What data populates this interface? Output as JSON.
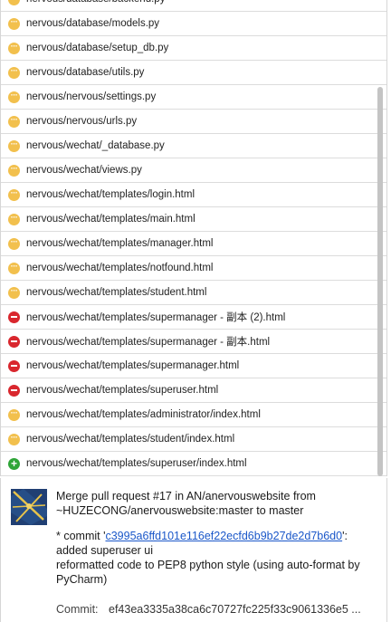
{
  "files": [
    {
      "path": "nervous/database/backend.py",
      "status": "modified"
    },
    {
      "path": "nervous/database/models.py",
      "status": "modified"
    },
    {
      "path": "nervous/database/setup_db.py",
      "status": "modified"
    },
    {
      "path": "nervous/database/utils.py",
      "status": "modified"
    },
    {
      "path": "nervous/nervous/settings.py",
      "status": "modified"
    },
    {
      "path": "nervous/nervous/urls.py",
      "status": "modified"
    },
    {
      "path": "nervous/wechat/_database.py",
      "status": "modified"
    },
    {
      "path": "nervous/wechat/views.py",
      "status": "modified"
    },
    {
      "path": "nervous/wechat/templates/login.html",
      "status": "modified"
    },
    {
      "path": "nervous/wechat/templates/main.html",
      "status": "modified"
    },
    {
      "path": "nervous/wechat/templates/manager.html",
      "status": "modified"
    },
    {
      "path": "nervous/wechat/templates/notfound.html",
      "status": "modified"
    },
    {
      "path": "nervous/wechat/templates/student.html",
      "status": "modified"
    },
    {
      "path": "nervous/wechat/templates/supermanager - 副本 (2).html",
      "status": "deleted"
    },
    {
      "path": "nervous/wechat/templates/supermanager - 副本.html",
      "status": "deleted"
    },
    {
      "path": "nervous/wechat/templates/supermanager.html",
      "status": "deleted"
    },
    {
      "path": "nervous/wechat/templates/superuser.html",
      "status": "deleted"
    },
    {
      "path": "nervous/wechat/templates/administrator/index.html",
      "status": "modified"
    },
    {
      "path": "nervous/wechat/templates/student/index.html",
      "status": "modified"
    },
    {
      "path": "nervous/wechat/templates/superuser/index.html",
      "status": "added"
    }
  ],
  "status_colors": {
    "modified": "#f2c04d",
    "deleted": "#d9272e",
    "added": "#2fa538"
  },
  "commit": {
    "title_line1": "Merge pull request #17 in AN/anervouswebsite from",
    "title_line2": "~HUZECONG/anervouswebsite:master to master",
    "bullet_prefix": "* commit '",
    "hash_link": "c3995a6ffd101e116ef22ecfd6b9b27de2d7b6d0",
    "bullet_suffix": "':",
    "body_line1": "added superuser ui",
    "body_line2": "reformatted code to PEP8 python style (using auto-format by",
    "body_line3": "PyCharm)",
    "meta_label": "Commit:",
    "meta_value": "ef43ea3335a38ca6c70727fc225f33c9061336e5 ..."
  }
}
